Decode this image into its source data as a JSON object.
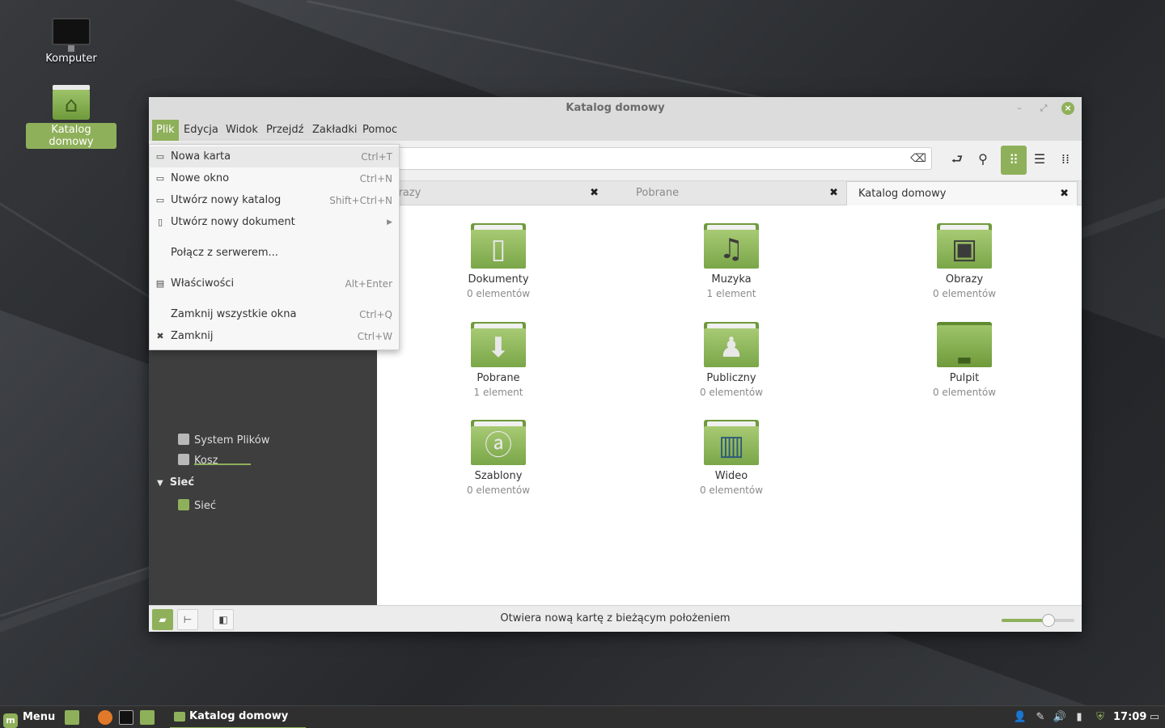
{
  "desktop": {
    "icons": [
      {
        "label": "Komputer"
      },
      {
        "label": "Katalog domowy"
      }
    ]
  },
  "window": {
    "title": "Katalog domowy",
    "menubar": [
      "Plik",
      "Edycja",
      "Widok",
      "Przejdź",
      "Zakładki",
      "Pomoc"
    ],
    "tabs": [
      {
        "label": "Obrazy"
      },
      {
        "label": "Pobrane"
      },
      {
        "label": "Katalog domowy"
      }
    ],
    "sidebar": {
      "items": [
        {
          "label": "System Plików",
          "icon": "drive-icon"
        },
        {
          "label": "Kosz",
          "icon": "trash-icon"
        }
      ],
      "sections": [
        {
          "label": "Sieć",
          "items": [
            {
              "label": "Sieć",
              "icon": "network-icon"
            }
          ]
        }
      ]
    },
    "files": [
      {
        "name": "Dokumenty",
        "count": "0 elementów",
        "emblem": "document-icon"
      },
      {
        "name": "Muzyka",
        "count": "1 element",
        "emblem": "music-icon"
      },
      {
        "name": "Obrazy",
        "count": "0 elementów",
        "emblem": "picture-icon"
      },
      {
        "name": "Pobrane",
        "count": "1 element",
        "emblem": "download-icon"
      },
      {
        "name": "Publiczny",
        "count": "0 elementów",
        "emblem": "person-icon"
      },
      {
        "name": "Pulpit",
        "count": "0 elementów",
        "emblem": "desktop-icon"
      },
      {
        "name": "Szablony",
        "count": "0 elementów",
        "emblem": "template-icon"
      },
      {
        "name": "Wideo",
        "count": "0 elementów",
        "emblem": "film-icon"
      }
    ],
    "status": "Otwiera nową kartę z bieżącym położeniem",
    "zoom_fraction": 0.64
  },
  "file_menu": {
    "items": [
      {
        "label": "Nowa karta",
        "shortcut": "Ctrl+T",
        "icon": "new-tab-icon"
      },
      {
        "label": "Nowe okno",
        "shortcut": "Ctrl+N",
        "icon": "new-window-icon"
      },
      {
        "label": "Utwórz nowy katalog",
        "shortcut": "Shift+Ctrl+N",
        "icon": "new-folder-icon"
      },
      {
        "label": "Utwórz nowy dokument",
        "shortcut": "",
        "icon": "new-document-icon"
      },
      {
        "label": "Połącz z serwerem...",
        "shortcut": "",
        "icon": ""
      },
      {
        "label": "Właściwości",
        "shortcut": "Alt+Enter",
        "icon": "properties-icon"
      },
      {
        "label": "Zamknij wszystkie okna",
        "shortcut": "Ctrl+Q",
        "icon": ""
      },
      {
        "label": "Zamknij",
        "shortcut": "Ctrl+W",
        "icon": "close-icon"
      }
    ]
  },
  "taskbar": {
    "menu_label": "Menu",
    "window_label": "Katalog domowy",
    "clock": "17:09"
  },
  "colors": {
    "accent": "#8fb05a"
  }
}
